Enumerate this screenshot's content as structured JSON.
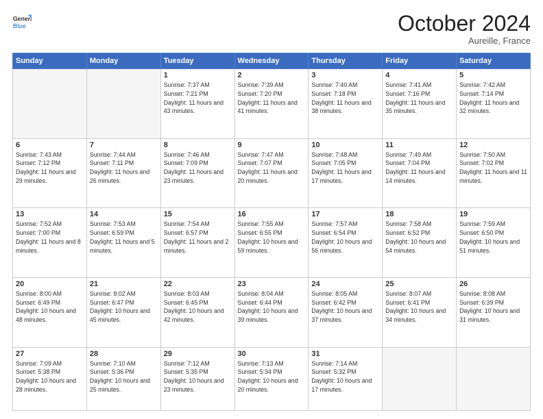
{
  "header": {
    "logo": {
      "line1": "General",
      "line2": "Blue"
    },
    "title": "October 2024",
    "location": "Aureille, France"
  },
  "weekdays": [
    "Sunday",
    "Monday",
    "Tuesday",
    "Wednesday",
    "Thursday",
    "Friday",
    "Saturday"
  ],
  "weeks": [
    [
      {
        "day": "",
        "empty": true
      },
      {
        "day": "",
        "empty": true
      },
      {
        "day": "1",
        "sunrise": "Sunrise: 7:37 AM",
        "sunset": "Sunset: 7:21 PM",
        "daylight": "Daylight: 11 hours and 43 minutes."
      },
      {
        "day": "2",
        "sunrise": "Sunrise: 7:39 AM",
        "sunset": "Sunset: 7:20 PM",
        "daylight": "Daylight: 11 hours and 41 minutes."
      },
      {
        "day": "3",
        "sunrise": "Sunrise: 7:40 AM",
        "sunset": "Sunset: 7:18 PM",
        "daylight": "Daylight: 11 hours and 38 minutes."
      },
      {
        "day": "4",
        "sunrise": "Sunrise: 7:41 AM",
        "sunset": "Sunset: 7:16 PM",
        "daylight": "Daylight: 11 hours and 35 minutes."
      },
      {
        "day": "5",
        "sunrise": "Sunrise: 7:42 AM",
        "sunset": "Sunset: 7:14 PM",
        "daylight": "Daylight: 11 hours and 32 minutes."
      }
    ],
    [
      {
        "day": "6",
        "sunrise": "Sunrise: 7:43 AM",
        "sunset": "Sunset: 7:12 PM",
        "daylight": "Daylight: 11 hours and 29 minutes."
      },
      {
        "day": "7",
        "sunrise": "Sunrise: 7:44 AM",
        "sunset": "Sunset: 7:11 PM",
        "daylight": "Daylight: 11 hours and 26 minutes."
      },
      {
        "day": "8",
        "sunrise": "Sunrise: 7:46 AM",
        "sunset": "Sunset: 7:09 PM",
        "daylight": "Daylight: 11 hours and 23 minutes."
      },
      {
        "day": "9",
        "sunrise": "Sunrise: 7:47 AM",
        "sunset": "Sunset: 7:07 PM",
        "daylight": "Daylight: 11 hours and 20 minutes."
      },
      {
        "day": "10",
        "sunrise": "Sunrise: 7:48 AM",
        "sunset": "Sunset: 7:05 PM",
        "daylight": "Daylight: 11 hours and 17 minutes."
      },
      {
        "day": "11",
        "sunrise": "Sunrise: 7:49 AM",
        "sunset": "Sunset: 7:04 PM",
        "daylight": "Daylight: 11 hours and 14 minutes."
      },
      {
        "day": "12",
        "sunrise": "Sunrise: 7:50 AM",
        "sunset": "Sunset: 7:02 PM",
        "daylight": "Daylight: 11 hours and 11 minutes."
      }
    ],
    [
      {
        "day": "13",
        "sunrise": "Sunrise: 7:52 AM",
        "sunset": "Sunset: 7:00 PM",
        "daylight": "Daylight: 11 hours and 8 minutes."
      },
      {
        "day": "14",
        "sunrise": "Sunrise: 7:53 AM",
        "sunset": "Sunset: 6:59 PM",
        "daylight": "Daylight: 11 hours and 5 minutes."
      },
      {
        "day": "15",
        "sunrise": "Sunrise: 7:54 AM",
        "sunset": "Sunset: 6:57 PM",
        "daylight": "Daylight: 11 hours and 2 minutes."
      },
      {
        "day": "16",
        "sunrise": "Sunrise: 7:55 AM",
        "sunset": "Sunset: 6:55 PM",
        "daylight": "Daylight: 10 hours and 59 minutes."
      },
      {
        "day": "17",
        "sunrise": "Sunrise: 7:57 AM",
        "sunset": "Sunset: 6:54 PM",
        "daylight": "Daylight: 10 hours and 56 minutes."
      },
      {
        "day": "18",
        "sunrise": "Sunrise: 7:58 AM",
        "sunset": "Sunset: 6:52 PM",
        "daylight": "Daylight: 10 hours and 54 minutes."
      },
      {
        "day": "19",
        "sunrise": "Sunrise: 7:59 AM",
        "sunset": "Sunset: 6:50 PM",
        "daylight": "Daylight: 10 hours and 51 minutes."
      }
    ],
    [
      {
        "day": "20",
        "sunrise": "Sunrise: 8:00 AM",
        "sunset": "Sunset: 6:49 PM",
        "daylight": "Daylight: 10 hours and 48 minutes."
      },
      {
        "day": "21",
        "sunrise": "Sunrise: 8:02 AM",
        "sunset": "Sunset: 6:47 PM",
        "daylight": "Daylight: 10 hours and 45 minutes."
      },
      {
        "day": "22",
        "sunrise": "Sunrise: 8:03 AM",
        "sunset": "Sunset: 6:45 PM",
        "daylight": "Daylight: 10 hours and 42 minutes."
      },
      {
        "day": "23",
        "sunrise": "Sunrise: 8:04 AM",
        "sunset": "Sunset: 6:44 PM",
        "daylight": "Daylight: 10 hours and 39 minutes."
      },
      {
        "day": "24",
        "sunrise": "Sunrise: 8:05 AM",
        "sunset": "Sunset: 6:42 PM",
        "daylight": "Daylight: 10 hours and 37 minutes."
      },
      {
        "day": "25",
        "sunrise": "Sunrise: 8:07 AM",
        "sunset": "Sunset: 6:41 PM",
        "daylight": "Daylight: 10 hours and 34 minutes."
      },
      {
        "day": "26",
        "sunrise": "Sunrise: 8:08 AM",
        "sunset": "Sunset: 6:39 PM",
        "daylight": "Daylight: 10 hours and 31 minutes."
      }
    ],
    [
      {
        "day": "27",
        "sunrise": "Sunrise: 7:09 AM",
        "sunset": "Sunset: 5:38 PM",
        "daylight": "Daylight: 10 hours and 28 minutes."
      },
      {
        "day": "28",
        "sunrise": "Sunrise: 7:10 AM",
        "sunset": "Sunset: 5:36 PM",
        "daylight": "Daylight: 10 hours and 25 minutes."
      },
      {
        "day": "29",
        "sunrise": "Sunrise: 7:12 AM",
        "sunset": "Sunset: 5:35 PM",
        "daylight": "Daylight: 10 hours and 23 minutes."
      },
      {
        "day": "30",
        "sunrise": "Sunrise: 7:13 AM",
        "sunset": "Sunset: 5:34 PM",
        "daylight": "Daylight: 10 hours and 20 minutes."
      },
      {
        "day": "31",
        "sunrise": "Sunrise: 7:14 AM",
        "sunset": "Sunset: 5:32 PM",
        "daylight": "Daylight: 10 hours and 17 minutes."
      },
      {
        "day": "",
        "empty": true
      },
      {
        "day": "",
        "empty": true
      }
    ]
  ]
}
